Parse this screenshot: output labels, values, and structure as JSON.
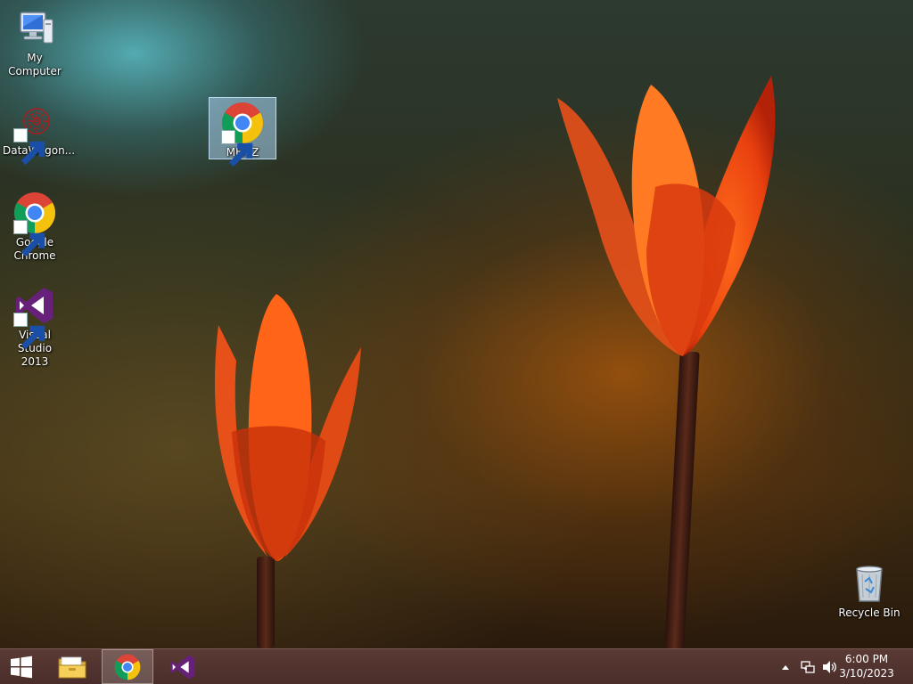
{
  "desktop": {
    "icons": [
      {
        "label": "My Computer",
        "icon": "computer-icon"
      },
      {
        "label": "DataWagon...",
        "icon": "datawagon-icon"
      },
      {
        "label": "Google Chrome",
        "icon": "chrome-icon"
      },
      {
        "label": "Visual Studio 2013",
        "icon": "visual-studio-icon"
      },
      {
        "label": "MEMZ",
        "icon": "chrome-icon",
        "selected": true
      },
      {
        "label": "Recycle Bin",
        "icon": "recycle-bin-icon"
      }
    ]
  },
  "taskbar": {
    "pinned": [
      {
        "icon": "windows-start-icon"
      },
      {
        "icon": "file-explorer-icon"
      },
      {
        "icon": "chrome-icon",
        "active": true
      },
      {
        "icon": "visual-studio-icon"
      }
    ],
    "tray": {
      "icons": [
        "show-hidden-icons-chevron",
        "network-icon",
        "volume-icon"
      ],
      "time": "6:00 PM",
      "date": "3/10/2023"
    }
  },
  "colors": {
    "taskbar": "#4a2d2a",
    "selection": "#aacdeb",
    "chrome_red": "#db4437",
    "chrome_yellow": "#f4c20d",
    "chrome_green": "#0f9d58",
    "chrome_blue": "#4285f4",
    "vs_purple": "#68217a"
  }
}
